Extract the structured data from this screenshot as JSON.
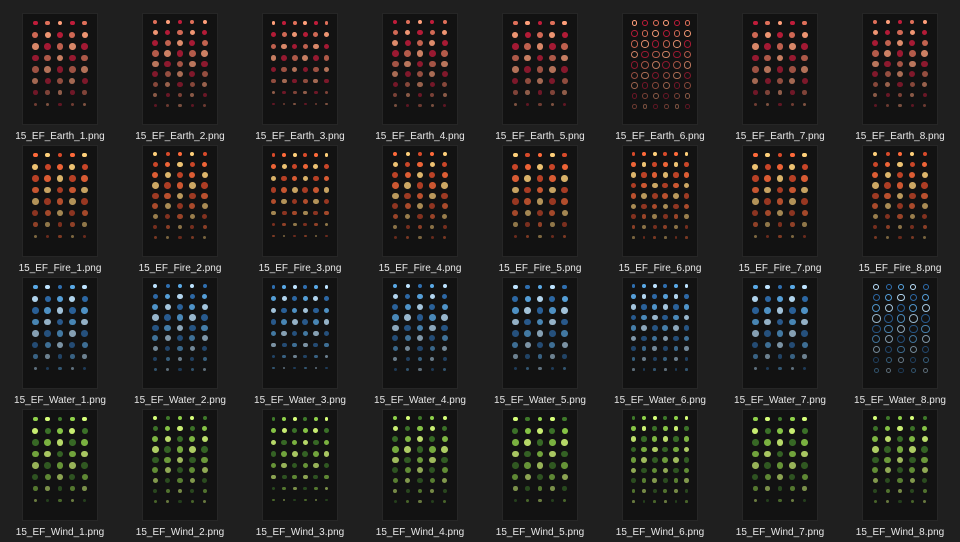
{
  "rows": [
    {
      "element": "Earth",
      "palette": [
        "#c01c3a",
        "#e0705a",
        "#ff9f7a"
      ],
      "files": [
        "15_EF_Earth_1.png",
        "15_EF_Earth_2.png",
        "15_EF_Earth_3.png",
        "15_EF_Earth_4.png",
        "15_EF_Earth_5.png",
        "15_EF_Earth_6.png",
        "15_EF_Earth_7.png",
        "15_EF_Earth_8.png"
      ]
    },
    {
      "element": "Fire",
      "palette": [
        "#ff6a3a",
        "#ffd07a",
        "#d84a2a"
      ],
      "files": [
        "15_EF_Fire_1.png",
        "15_EF_Fire_2.png",
        "15_EF_Fire_3.png",
        "15_EF_Fire_4.png",
        "15_EF_Fire_5.png",
        "15_EF_Fire_6.png",
        "15_EF_Fire_7.png",
        "15_EF_Fire_8.png"
      ]
    },
    {
      "element": "Water",
      "palette": [
        "#5aa9e6",
        "#bde3ff",
        "#2f6fb0"
      ],
      "files": [
        "15_EF_Water_1.png",
        "15_EF_Water_2.png",
        "15_EF_Water_3.png",
        "15_EF_Water_4.png",
        "15_EF_Water_5.png",
        "15_EF_Water_6.png",
        "15_EF_Water_7.png",
        "15_EF_Water_8.png"
      ]
    },
    {
      "element": "Wind",
      "palette": [
        "#8fd14a",
        "#d7ff7a",
        "#3f7a2a"
      ],
      "files": [
        "15_EF_Wind_1.png",
        "15_EF_Wind_2.png",
        "15_EF_Wind_3.png",
        "15_EF_Wind_4.png",
        "15_EF_Wind_5.png",
        "15_EF_Wind_6.png",
        "15_EF_Wind_7.png",
        "15_EF_Wind_8.png"
      ]
    }
  ]
}
